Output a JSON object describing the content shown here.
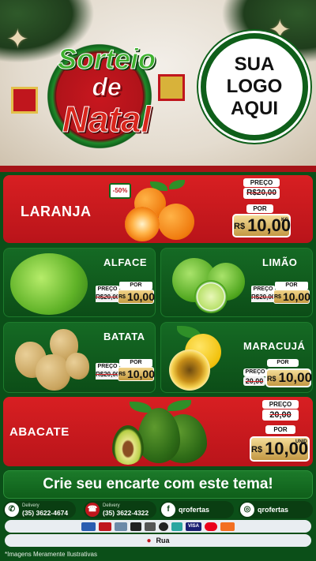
{
  "header": {
    "emblem_line1": "Sorteio",
    "emblem_line2": "de",
    "emblem_line3": "Natal",
    "logo_line1": "SUA",
    "logo_line2": "LOGO",
    "logo_line3": "AQUI"
  },
  "products": [
    {
      "name": "LARANJA",
      "discount": "-50%",
      "price_label": "PREÇO",
      "old_price": "R$20,00",
      "new_label": "POR",
      "currency": "R$",
      "new_price": "10,00",
      "unit": "KG"
    },
    {
      "name": "ALFACE",
      "price_label": "PREÇO",
      "old_price": "R$20,00",
      "new_label": "POR",
      "currency": "R$",
      "new_price": "10,00"
    },
    {
      "name": "LIMÃO",
      "price_label": "PREÇO",
      "old_price": "R$20,00",
      "new_label": "POR",
      "currency": "R$",
      "new_price": "10,00"
    },
    {
      "name": "BATATA",
      "price_label": "PREÇO",
      "old_price": "R$20,00",
      "new_label": "POR",
      "currency": "R$",
      "new_price": "10,00"
    },
    {
      "name": "MARACUJÁ",
      "price_label": "PREÇO",
      "old_price": "20,00",
      "new_label": "POR",
      "currency": "R$",
      "new_price": "10,00"
    },
    {
      "name": "ABACATE",
      "price_label": "PREÇO",
      "old_price": "20,00",
      "new_label": "POR",
      "currency": "R$",
      "new_price": "10,00",
      "unit": "UNID"
    }
  ],
  "cta": "Crie seu encarte com este tema!",
  "contacts": {
    "whatsapp_label": "Delivery",
    "whatsapp_number": "(35) 3622-4674",
    "phone_label": "Delivery",
    "phone_number": "(35) 3622-4322",
    "facebook": "qrofertas",
    "instagram": "qrofertas"
  },
  "payments": [
    "VISA"
  ],
  "address": "Rua",
  "disclaimer": "*Imagens Meramente Ilustrativas",
  "colors": {
    "red": "#d81f22",
    "green": "#0b4f18",
    "gold": "#c49a3f"
  }
}
